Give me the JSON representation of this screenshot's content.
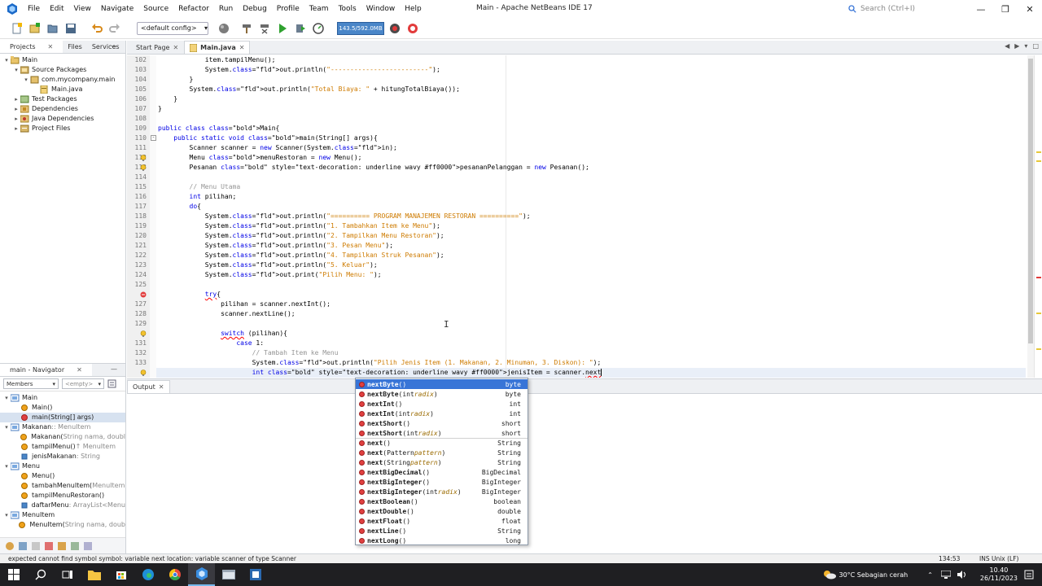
{
  "window": {
    "title": "Main - Apache NetBeans IDE 17",
    "search_placeholder": "Search (Ctrl+I)"
  },
  "menu": [
    "File",
    "Edit",
    "View",
    "Navigate",
    "Source",
    "Refactor",
    "Run",
    "Debug",
    "Profile",
    "Team",
    "Tools",
    "Window",
    "Help"
  ],
  "toolbar": {
    "config": "<default config>",
    "memory": "143.5/592.0MB"
  },
  "projects_panel": {
    "tabs": [
      "Projects",
      "Files",
      "Services"
    ],
    "tree": [
      {
        "label": "Main",
        "level": 0,
        "icon": "project-icon",
        "twisty": "▾"
      },
      {
        "label": "Source Packages",
        "level": 1,
        "icon": "source-packages-icon",
        "twisty": "▾"
      },
      {
        "label": "com.mycompany.main",
        "level": 2,
        "icon": "package-icon",
        "twisty": "▾"
      },
      {
        "label": "Main.java",
        "level": 3,
        "icon": "java-file-icon",
        "twisty": ""
      },
      {
        "label": "Test Packages",
        "level": 1,
        "icon": "test-packages-icon",
        "twisty": "▸"
      },
      {
        "label": "Dependencies",
        "level": 1,
        "icon": "dependencies-icon",
        "twisty": "▸"
      },
      {
        "label": "Java Dependencies",
        "level": 1,
        "icon": "java-dependencies-icon",
        "twisty": "▸"
      },
      {
        "label": "Project Files",
        "level": 1,
        "icon": "project-files-icon",
        "twisty": "▸"
      }
    ]
  },
  "navigator": {
    "title": "main - Navigator",
    "members_combo": "Members",
    "empty_combo": "<empty>",
    "items": [
      {
        "label": "Main",
        "suffix": "",
        "level": 0,
        "kind": "class",
        "twisty": "▾",
        "selected": false
      },
      {
        "label": "Main()",
        "suffix": "",
        "level": 1,
        "kind": "method",
        "twisty": "",
        "selected": false
      },
      {
        "label": "main(String[] args)",
        "suffix": "",
        "level": 1,
        "kind": "method",
        "twisty": "",
        "selected": true
      },
      {
        "label": "Makanan",
        "suffix": " :: MenuItem",
        "level": 0,
        "kind": "class",
        "twisty": "▾",
        "selected": false
      },
      {
        "label": "Makanan(",
        "suffix": "String nama, doubl",
        "level": 1,
        "kind": "method",
        "twisty": "",
        "selected": false
      },
      {
        "label": "tampilMenu()",
        "suffix": " ↑ MenuItem",
        "level": 1,
        "kind": "method",
        "twisty": "",
        "selected": false
      },
      {
        "label": "jenisMakanan",
        "suffix": " : String",
        "level": 1,
        "kind": "field",
        "twisty": "",
        "selected": false
      },
      {
        "label": "Menu",
        "suffix": "",
        "level": 0,
        "kind": "class",
        "twisty": "▾",
        "selected": false
      },
      {
        "label": "Menu()",
        "suffix": "",
        "level": 1,
        "kind": "method",
        "twisty": "",
        "selected": false
      },
      {
        "label": "tambahMenuItem(",
        "suffix": "MenuItem",
        "level": 1,
        "kind": "method",
        "twisty": "",
        "selected": false
      },
      {
        "label": "tampilMenuRestoran()",
        "suffix": "",
        "level": 1,
        "kind": "method",
        "twisty": "",
        "selected": false
      },
      {
        "label": "daftarMenu",
        "suffix": " : ArrayList<Menu",
        "level": 1,
        "kind": "field",
        "twisty": "",
        "selected": false
      },
      {
        "label": "MenuItem",
        "suffix": "",
        "level": 0,
        "kind": "class",
        "twisty": "▾",
        "selected": false
      },
      {
        "label": "MenuItem(",
        "suffix": "String nama, doub",
        "level": 1,
        "kind": "method",
        "twisty": "",
        "selected": false
      }
    ]
  },
  "editor": {
    "tabs": [
      {
        "label": "Start Page",
        "active": false
      },
      {
        "label": "Main.java",
        "active": true
      }
    ],
    "lines": [
      {
        "n": "102",
        "t": "            item.tampilMenu();",
        "ann": ""
      },
      {
        "n": "103",
        "t": "            System.out.println(\"-------------------------\");",
        "ann": ""
      },
      {
        "n": "104",
        "t": "        }",
        "ann": ""
      },
      {
        "n": "105",
        "t": "        System.out.println(\"Total Biaya: \" + hitungTotalBiaya());",
        "ann": ""
      },
      {
        "n": "106",
        "t": "    }",
        "ann": ""
      },
      {
        "n": "107",
        "t": "}",
        "ann": ""
      },
      {
        "n": "108",
        "t": "",
        "ann": ""
      },
      {
        "n": "109",
        "t": "public class Main{",
        "ann": ""
      },
      {
        "n": "110",
        "t": "    public static void main(String[] args){",
        "ann": "fold"
      },
      {
        "n": "111",
        "t": "        Scanner scanner = new Scanner(System.in);",
        "ann": ""
      },
      {
        "n": "112",
        "t": "        Menu menuRestoran = new Menu();",
        "ann": "hint"
      },
      {
        "n": "113",
        "t": "        Pesanan pesananPelanggan = new Pesanan();",
        "ann": "hint"
      },
      {
        "n": "114",
        "t": "",
        "ann": ""
      },
      {
        "n": "115",
        "t": "        // Menu Utama",
        "ann": ""
      },
      {
        "n": "116",
        "t": "        int pilihan;",
        "ann": ""
      },
      {
        "n": "117",
        "t": "        do{",
        "ann": ""
      },
      {
        "n": "118",
        "t": "            System.out.println(\"========== PROGRAM MANAJEMEN RESTORAN ==========\");",
        "ann": ""
      },
      {
        "n": "119",
        "t": "            System.out.println(\"1. Tambahkan Item ke Menu\");",
        "ann": ""
      },
      {
        "n": "120",
        "t": "            System.out.println(\"2. Tampilkan Menu Restoran\");",
        "ann": ""
      },
      {
        "n": "121",
        "t": "            System.out.println(\"3. Pesan Menu\");",
        "ann": ""
      },
      {
        "n": "122",
        "t": "            System.out.println(\"4. Tampilkan Struk Pesanan\");",
        "ann": ""
      },
      {
        "n": "123",
        "t": "            System.out.println(\"5. Keluar\");",
        "ann": ""
      },
      {
        "n": "124",
        "t": "            System.out.print(\"Pilih Menu: \");",
        "ann": ""
      },
      {
        "n": "125",
        "t": "",
        "ann": ""
      },
      {
        "n": "",
        "t": "            try{",
        "ann": "error"
      },
      {
        "n": "127",
        "t": "                pilihan = scanner.nextInt();",
        "ann": ""
      },
      {
        "n": "128",
        "t": "                scanner.nextLine();",
        "ann": ""
      },
      {
        "n": "129",
        "t": "",
        "ann": ""
      },
      {
        "n": "",
        "t": "                switch (pilihan){",
        "ann": "hint"
      },
      {
        "n": "131",
        "t": "                    case 1:",
        "ann": ""
      },
      {
        "n": "132",
        "t": "                        // Tambah Item ke Menu",
        "ann": ""
      },
      {
        "n": "133",
        "t": "                        System.out.println(\"Pilih Jenis Item (1. Makanan, 2. Minuman, 3. Diskon): \");",
        "ann": ""
      },
      {
        "n": "",
        "t": "                        int jenisItem = scanner.next",
        "ann": "hint"
      }
    ]
  },
  "output": {
    "tab": "Output"
  },
  "completion": {
    "items": [
      {
        "name": "nextByte",
        "params": "",
        "ret": "byte"
      },
      {
        "name": "nextByte",
        "params": "int radix",
        "ret": "byte"
      },
      {
        "name": "nextInt",
        "params": "",
        "ret": "int"
      },
      {
        "name": "nextInt",
        "params": "int radix",
        "ret": "int"
      },
      {
        "name": "nextShort",
        "params": "",
        "ret": "short"
      },
      {
        "name": "nextShort",
        "params": "int radix",
        "ret": "short"
      },
      {
        "name": "next",
        "params": "",
        "ret": "String"
      },
      {
        "name": "next",
        "params": "Pattern pattern",
        "ret": "String"
      },
      {
        "name": "next",
        "params": "String pattern",
        "ret": "String"
      },
      {
        "name": "nextBigDecimal",
        "params": "",
        "ret": "BigDecimal"
      },
      {
        "name": "nextBigInteger",
        "params": "",
        "ret": "BigInteger"
      },
      {
        "name": "nextBigInteger",
        "params": "int radix",
        "ret": "BigInteger"
      },
      {
        "name": "nextBoolean",
        "params": "",
        "ret": "boolean"
      },
      {
        "name": "nextDouble",
        "params": "",
        "ret": "double"
      },
      {
        "name": "nextFloat",
        "params": "",
        "ret": "float"
      },
      {
        "name": "nextLine",
        "params": "",
        "ret": "String"
      },
      {
        "name": "nextLong",
        "params": "",
        "ret": "long"
      }
    ]
  },
  "statusbar": {
    "message": "expected   cannot find symbol   symbol:  variable next   location: variable scanner of type Scanner",
    "position": "134:53",
    "mode": "INS  Unix (LF)"
  },
  "taskbar": {
    "weather": "30°C  Sebagian cerah",
    "time": "10.40",
    "date": "26/11/2023"
  },
  "colors": {
    "keyword": "#0000e6",
    "string": "#ce7b00",
    "comment": "#969696",
    "selection": "#3875d7",
    "taskbar": "#1f1f22"
  }
}
